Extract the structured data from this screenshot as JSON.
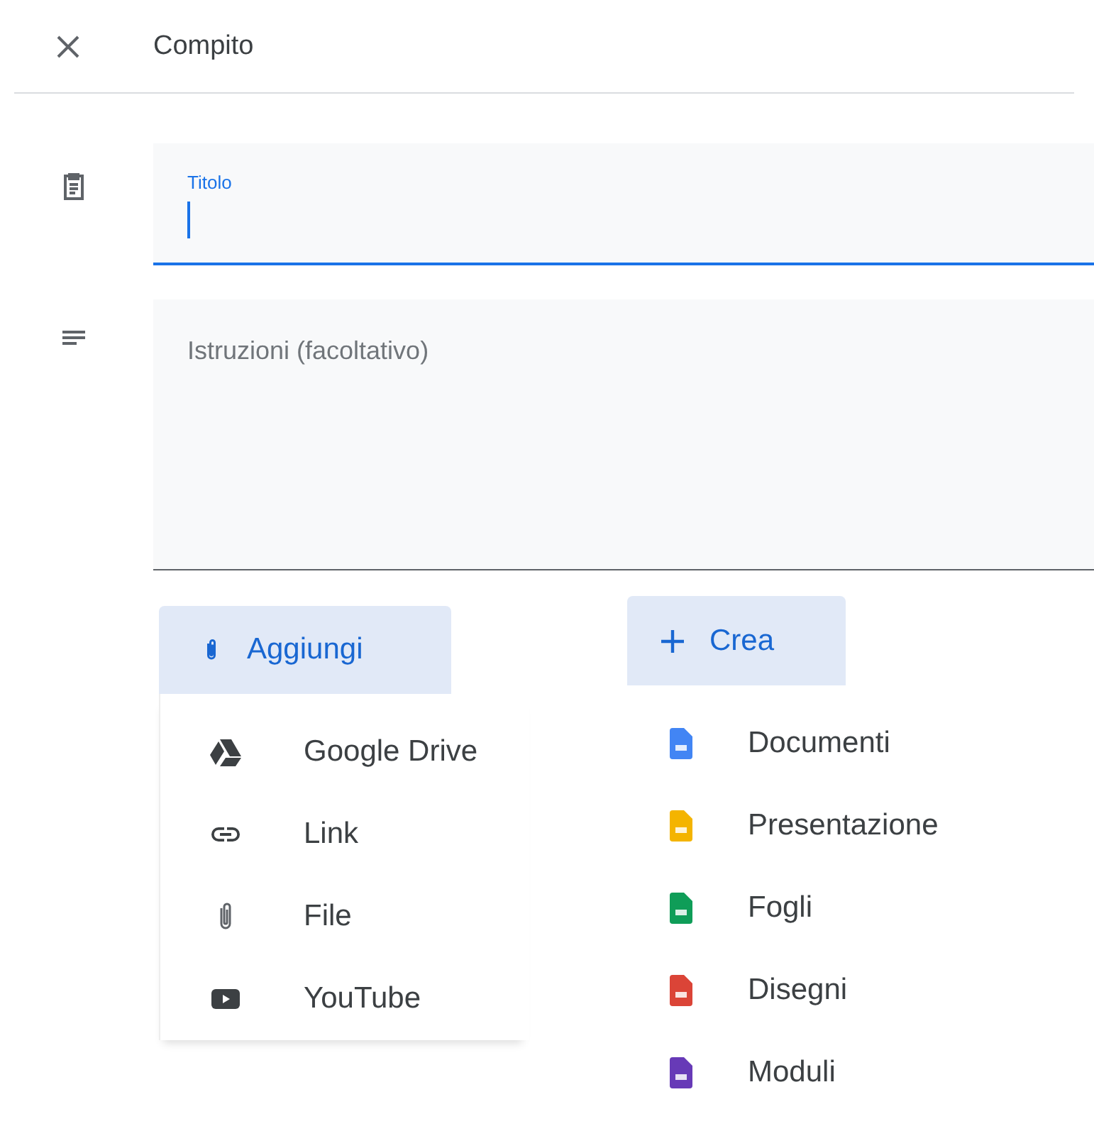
{
  "header": {
    "title": "Compito"
  },
  "title_field": {
    "label": "Titolo",
    "focused": true
  },
  "instructions_field": {
    "placeholder": "Istruzioni (facoltativo)"
  },
  "add_menu": {
    "button": "Aggiungi",
    "items": [
      {
        "kind": "drive",
        "label": "Google Drive"
      },
      {
        "kind": "link",
        "label": "Link"
      },
      {
        "kind": "file",
        "label": "File"
      },
      {
        "kind": "youtube",
        "label": "YouTube"
      }
    ]
  },
  "create_menu": {
    "button": "Crea",
    "items": [
      {
        "label": "Documenti",
        "color": "#4285f4"
      },
      {
        "label": "Presentazione",
        "color": "#f4b400"
      },
      {
        "label": "Fogli",
        "color": "#0f9d58"
      },
      {
        "label": "Disegni",
        "color": "#db4437"
      },
      {
        "label": "Moduli",
        "color": "#673ab7"
      }
    ]
  }
}
